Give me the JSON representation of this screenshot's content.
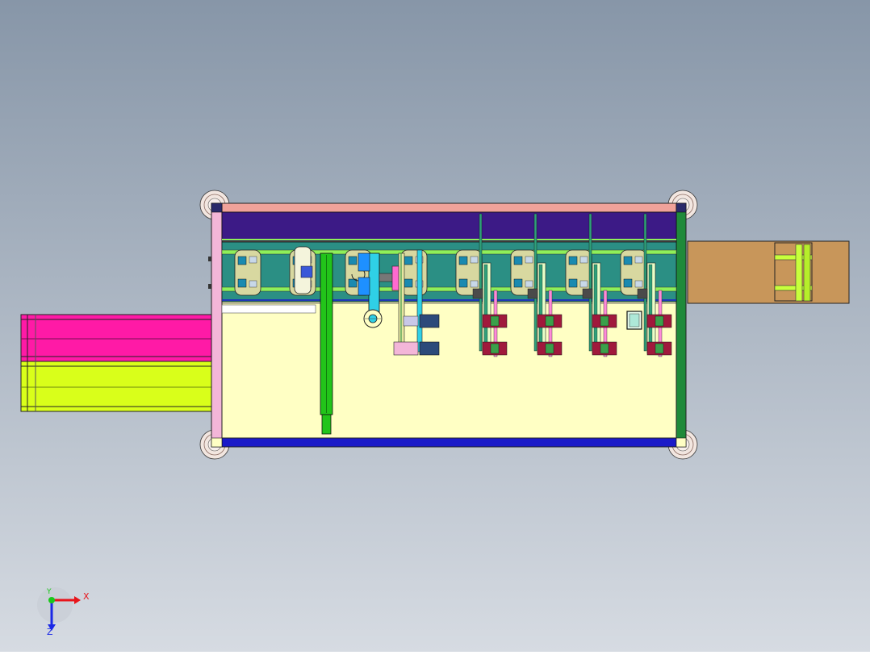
{
  "viewport": {
    "background_top": "#8796a8",
    "background_bottom": "#d6dbe2"
  },
  "colors": {
    "frame_top_rail": "#f0a29a",
    "frame_bottom_rail": "#1a1ac8",
    "frame_left_rail": "#f3b6d8",
    "frame_right_rail": "#1f8a3a",
    "bed": "#ffffc4",
    "navy_panel": "#3c1a86",
    "conveyor": "#2b8f84",
    "conveyor_rail": "#8ef05a",
    "left_magenta": "#ff1aa6",
    "left_lime": "#d9ff1a",
    "right_extension": "#c8965a",
    "cylinder_green": "#22c41a",
    "cyan_arm": "#2fd0e6",
    "maroon_block": "#a0193c",
    "lime_roller": "#c8ff3c"
  },
  "model_parts": {
    "station_count": 9,
    "cylinder_station_count": 4,
    "foot_pad_count": 4
  },
  "triad": {
    "x_label": "X",
    "y_label": "Y",
    "z_label": "Z",
    "x_color": "#e8141a",
    "y_color": "#1ac81a",
    "z_color": "#1a28e6"
  }
}
